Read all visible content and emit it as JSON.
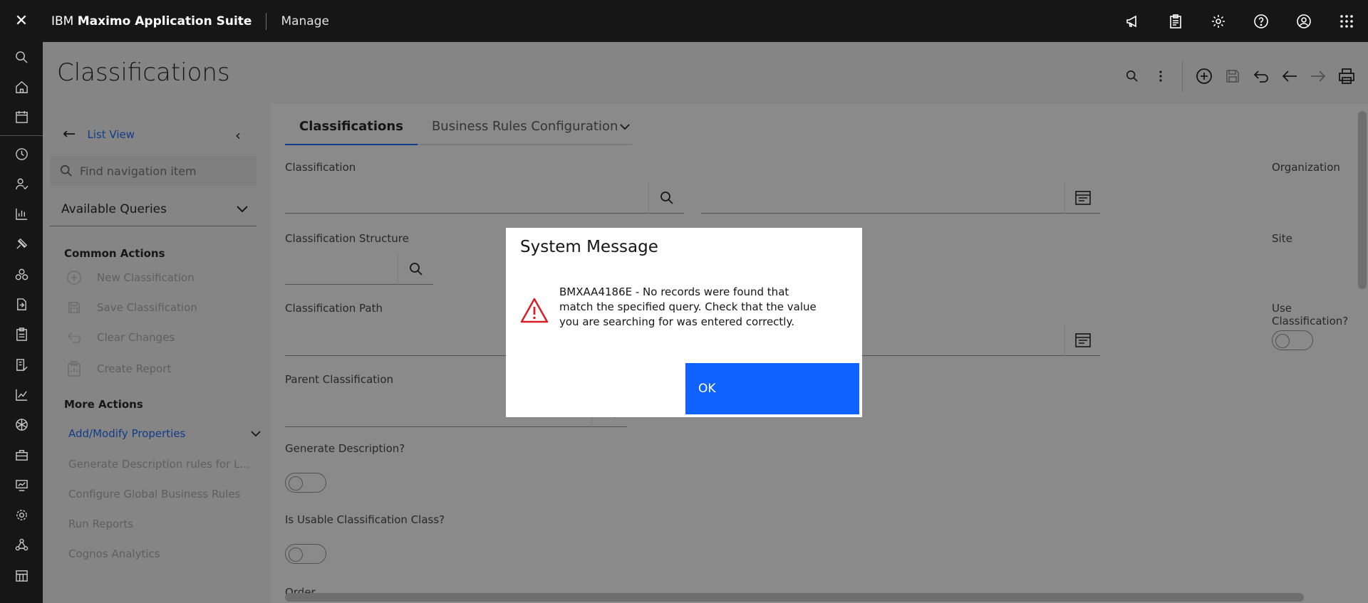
{
  "topbar": {
    "brand_prefix": "IBM",
    "brand_name": "Maximo Application Suite",
    "app_name": "Manage"
  },
  "page": {
    "title": "Classifications"
  },
  "sidenav": {
    "list_view": "List View",
    "search_placeholder": "Find navigation item",
    "queries_label": "Available Queries",
    "common_actions_heading": "Common Actions",
    "common_actions": [
      {
        "label": "New Classification",
        "icon": "add-circle-icon"
      },
      {
        "label": "Save Classification",
        "icon": "save-icon"
      },
      {
        "label": "Clear Changes",
        "icon": "undo-icon"
      },
      {
        "label": "Create Report",
        "icon": "report-icon"
      }
    ],
    "more_actions_heading": "More Actions",
    "more_actions": [
      {
        "label": "Add/Modify Properties"
      },
      {
        "label": "Generate Description rules for L..."
      },
      {
        "label": "Configure Global Business Rules"
      },
      {
        "label": "Run Reports"
      },
      {
        "label": "Cognos Analytics"
      }
    ]
  },
  "tabs": [
    {
      "label": "Classifications",
      "active": true
    },
    {
      "label": "Business Rules Configuration",
      "active": false
    }
  ],
  "form": {
    "classification": "Classification",
    "classification_structure": "Classification Structure",
    "classification_path": "Classification Path",
    "parent_classification": "Parent Classification",
    "generate_description": "Generate Description?",
    "is_usable": "Is Usable Classification Class?",
    "order": "Order",
    "organization": "Organization",
    "site": "Site",
    "use_classification": "Use Classification?"
  },
  "dialog": {
    "title": "System Message",
    "message": "BMXAA4186E - No records were found that match the specified query. Check that the value you are searching for was entered correctly.",
    "ok_label": "OK",
    "icon": "warning-icon"
  },
  "colors": {
    "accent": "#0f62fe",
    "topbar": "#161616",
    "warning": "#da1e28"
  }
}
